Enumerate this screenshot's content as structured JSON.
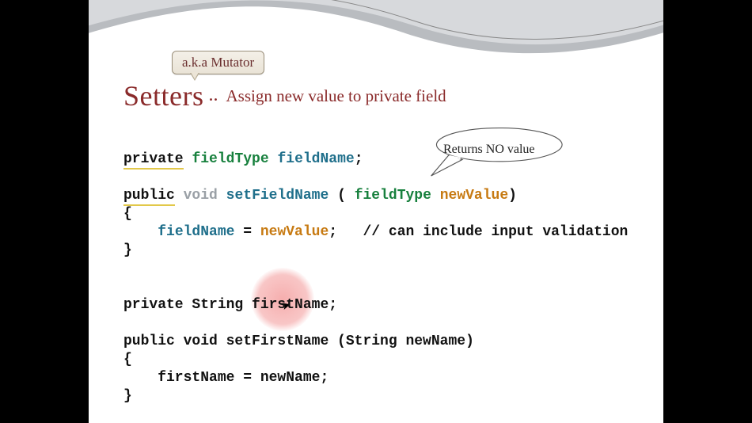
{
  "callout": {
    "label": "a.k.a  Mutator"
  },
  "title": {
    "main": "Setters",
    "dots": "..",
    "sub": "Assign new value to private field"
  },
  "speech": {
    "text": "Returns NO value"
  },
  "code": {
    "l1": {
      "private": "private",
      "fieldType": "fieldType",
      "fieldName": "fieldName",
      "semi": ";"
    },
    "l2": {
      "public": "public",
      "void": "void",
      "set": "set",
      "FieldName": "FieldName",
      "openParen": " ( ",
      "paramType": "fieldType",
      "paramName": "newValue",
      "closeParen": ")"
    },
    "l3": {
      "text": "{"
    },
    "l4": {
      "indent": "    ",
      "fieldName": "fieldName",
      "eq": " = ",
      "newValue": "newValue",
      "semi": ";",
      "comment": "   // can include input validation"
    },
    "l5": {
      "text": "}"
    },
    "l7": {
      "text": "private String firstName;"
    },
    "l9": {
      "text": "public void setFirstName (String newName)"
    },
    "l10": {
      "text": "{"
    },
    "l11": {
      "text": "    firstName = newName;"
    },
    "l12": {
      "text": "}"
    }
  }
}
